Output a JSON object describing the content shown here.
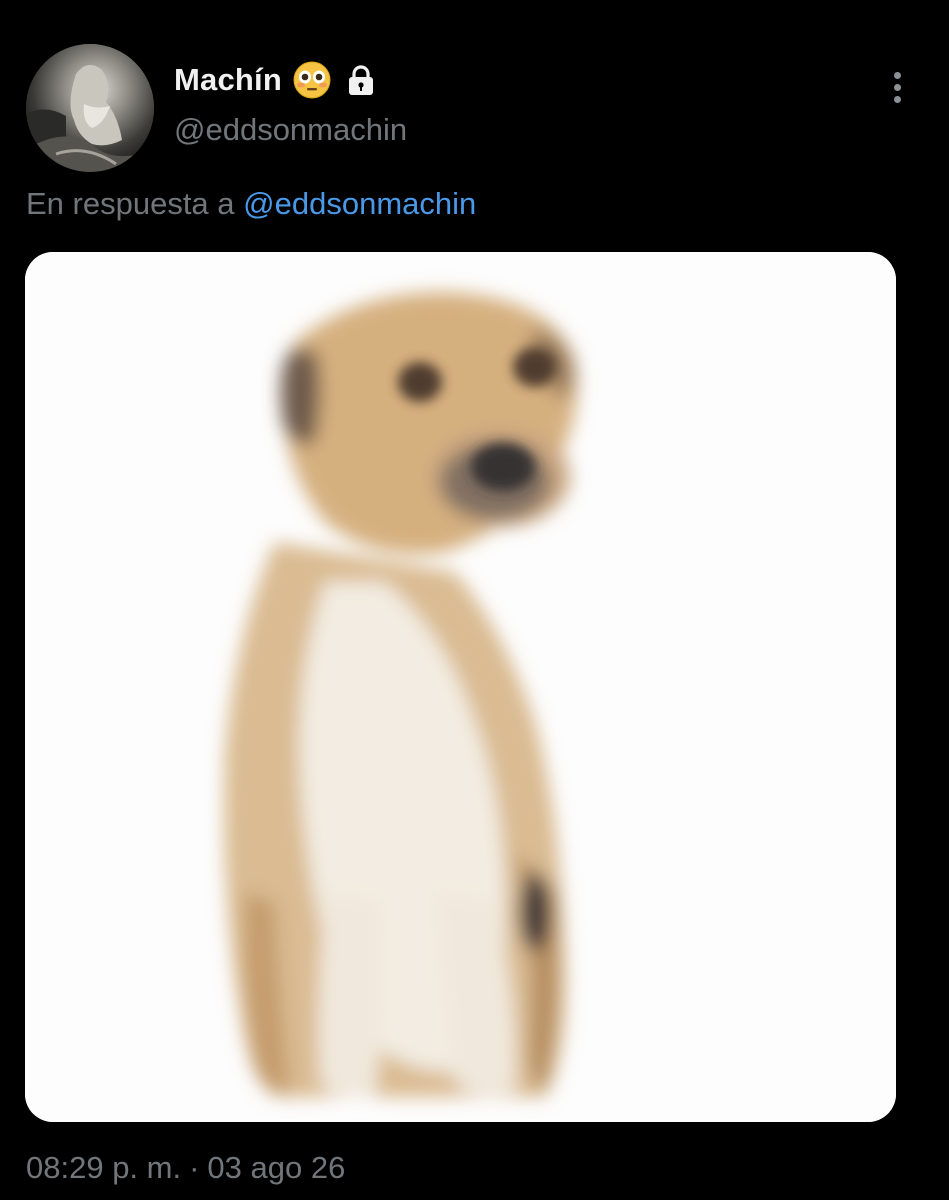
{
  "user": {
    "display_name": "Machín",
    "handle": "@eddsonmachin",
    "badges": [
      "flushed-face-emoji",
      "lock-icon"
    ]
  },
  "reply": {
    "prefix": "En respuesta a",
    "mention": "@eddsonmachin"
  },
  "media": {
    "description_icon": "photo-of-sad-dog"
  },
  "meta": {
    "time": "08:29 p. m.",
    "separator": "·",
    "date": "03 ago 26"
  },
  "colors": {
    "background": "#000000",
    "primary_text": "#f1f1f1",
    "secondary_text": "#71767b",
    "link": "#4a99e9"
  }
}
